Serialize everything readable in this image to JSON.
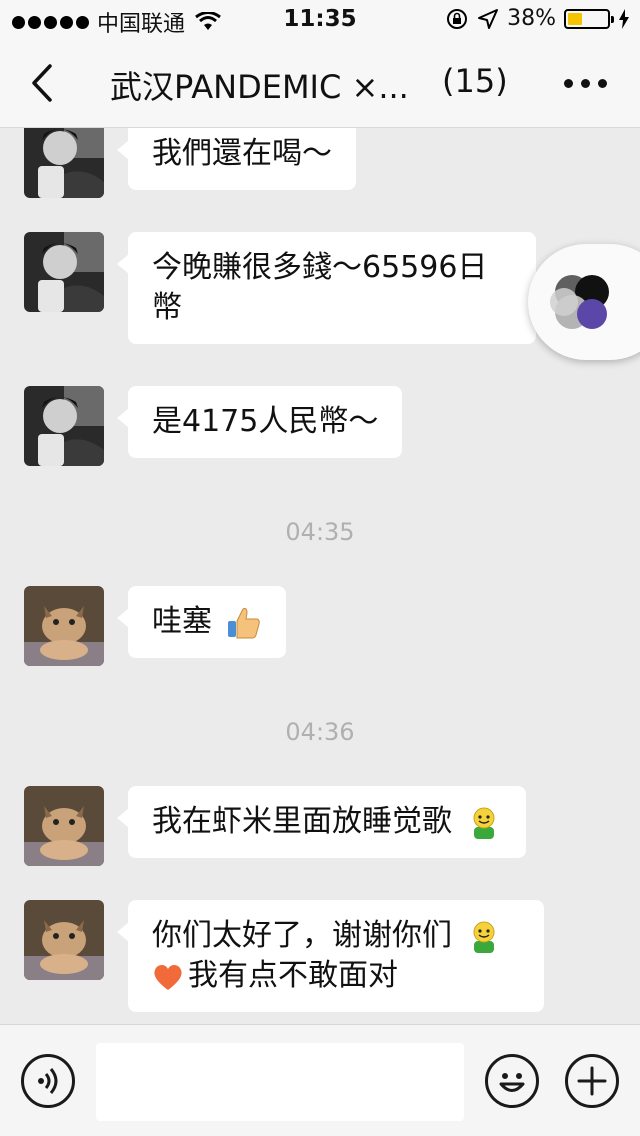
{
  "status_bar": {
    "carrier": "中国联通",
    "time": "11:35",
    "battery_percent": "38%",
    "battery_level": 0.38,
    "battery_color": "#f5c400"
  },
  "nav": {
    "back_icon": "chevron-left-icon",
    "title": "武汉PANDEMIC ×...",
    "member_count": "(15)",
    "more_icon": "more-dots-icon"
  },
  "messages": [
    {
      "type": "text",
      "sender": "user-a",
      "text": "我們還在喝～"
    },
    {
      "type": "text",
      "sender": "user-a",
      "line1": "今晚賺很多錢～65596日",
      "line2": "幣"
    },
    {
      "type": "text",
      "sender": "user-a",
      "text": "是4175人民幣～"
    },
    {
      "type": "time",
      "text": "04:35"
    },
    {
      "type": "text",
      "sender": "user-b",
      "text": "哇塞",
      "emoji": "thumbs-up-icon"
    },
    {
      "type": "time",
      "text": "04:36"
    },
    {
      "type": "text",
      "sender": "user-b",
      "text": "我在虾米里面放睡觉歌",
      "emoji": "smiley-figure-icon"
    },
    {
      "type": "text",
      "sender": "user-b",
      "line1": "你们太好了，谢谢你们",
      "line2": "我有点不敢面对",
      "emoji": "smiley-figure-icon",
      "emoji2": "heart-icon"
    }
  ],
  "input_bar": {
    "voice_icon": "voice-icon",
    "placeholder": "",
    "emoji_icon": "emoji-face-icon",
    "plus_icon": "plus-icon"
  },
  "colors": {
    "chat_background": "#ebebeb",
    "bubble": "#ffffff",
    "timestamp": "#b0b0b0",
    "bar_background": "#f7f7f7"
  }
}
